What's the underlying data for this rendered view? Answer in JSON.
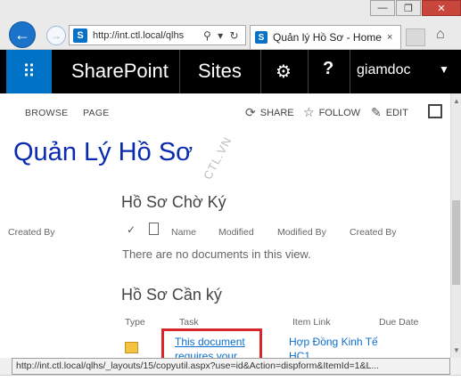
{
  "browser": {
    "address_url": "http://int.ctl.local/qlhs",
    "address_tools": "⚲ ▾ ↻",
    "tab_title": "Quản lý Hồ Sơ - Home",
    "tab_close": "×",
    "window_minimize": "—",
    "window_restore": "❐",
    "window_close": "✕"
  },
  "suite": {
    "brand": "SharePoint",
    "sites": "Sites",
    "user": "giamdoc"
  },
  "ribbon": {
    "tabs": [
      "BROWSE",
      "PAGE"
    ],
    "actions": {
      "share": "SHARE",
      "follow": "FOLLOW",
      "edit": "EDIT"
    }
  },
  "page": {
    "title": "Quản Lý Hồ Sơ",
    "watermark": "CTL.VN"
  },
  "section1": {
    "title": "Hồ Sơ Chờ Ký",
    "left_column": "Created By",
    "columns": [
      "Name",
      "Modified",
      "Modified By",
      "Created By"
    ],
    "empty_message": "There are no documents in this view."
  },
  "section2": {
    "title": "Hồ Sơ Cần ký",
    "columns": [
      "Type",
      "Task",
      "Item Link",
      "Due Date"
    ],
    "row": {
      "task_text": "This document requires your",
      "item_link_text": "Hợp Đồng Kinh Tế HC1"
    }
  },
  "status_bar": {
    "text": "http://int.ctl.local/qlhs/_layouts/15/copyutil.aspx?use=id&Action=dispform&ItemId=1&L..."
  },
  "colors": {
    "title_blue": "#0a2bb0",
    "link_blue": "#0b6fcf",
    "suite_black": "#000000",
    "waffle_blue": "#0072c6",
    "highlight_red": "#d9262b"
  }
}
